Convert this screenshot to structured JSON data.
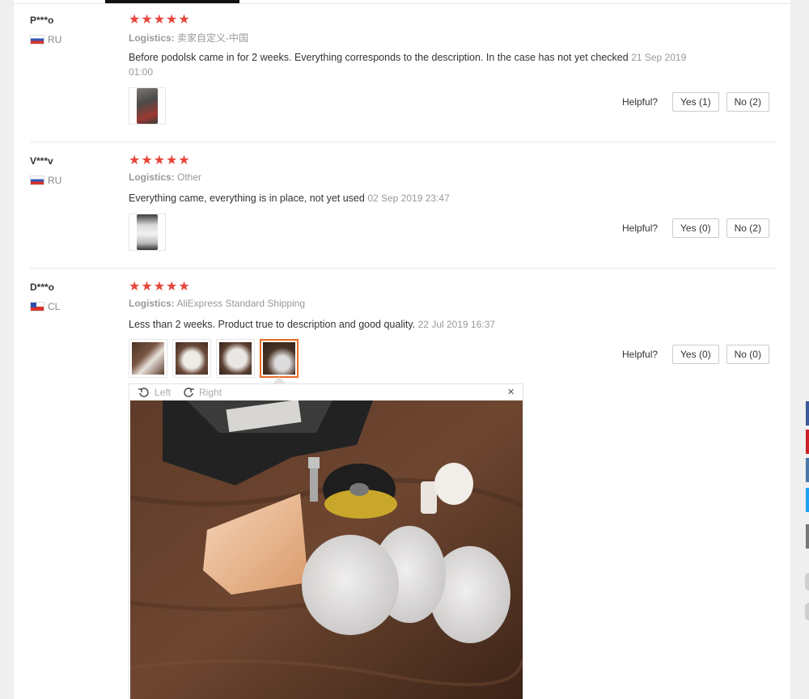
{
  "reviews": [
    {
      "user": "P***o",
      "country": "RU",
      "rating": "★★★★★",
      "logistics_label": "Logistics:",
      "logistics_value": "卖家自定义-中国",
      "text": "Before podolsk came in for 2 weeks. Everything corresponds to the description. In the case has not yet checked",
      "date": "21 Sep 2019 01:00",
      "helpful_label": "Helpful?",
      "yes": "Yes (1)",
      "no": "No (2)"
    },
    {
      "user": "V***v",
      "country": "RU",
      "rating": "★★★★★",
      "logistics_label": "Logistics:",
      "logistics_value": "Other",
      "text": "Everything came, everything is in place, not yet used",
      "date": "02 Sep 2019 23:47",
      "helpful_label": "Helpful?",
      "yes": "Yes (0)",
      "no": "No (2)"
    },
    {
      "user": "D***o",
      "country": "CL",
      "rating": "★★★★★",
      "logistics_label": "Logistics:",
      "logistics_value": "AliExpress Standard Shipping",
      "text": "Less than 2 weeks. Product true to description and good quality.",
      "date": "22 Jul 2019 16:37",
      "helpful_label": "Helpful?",
      "yes": "Yes (0)",
      "no": "No (0)"
    }
  ],
  "viewer": {
    "rotate_left": "Left",
    "rotate_right": "Right",
    "close": "×"
  },
  "colors": {
    "stars": "#e6453a",
    "selected_thumb": "#e96b21",
    "share_buttons": [
      "#3b5998",
      "#cb2027",
      "#4a76a8",
      "#1da1f2",
      "#777777"
    ]
  }
}
